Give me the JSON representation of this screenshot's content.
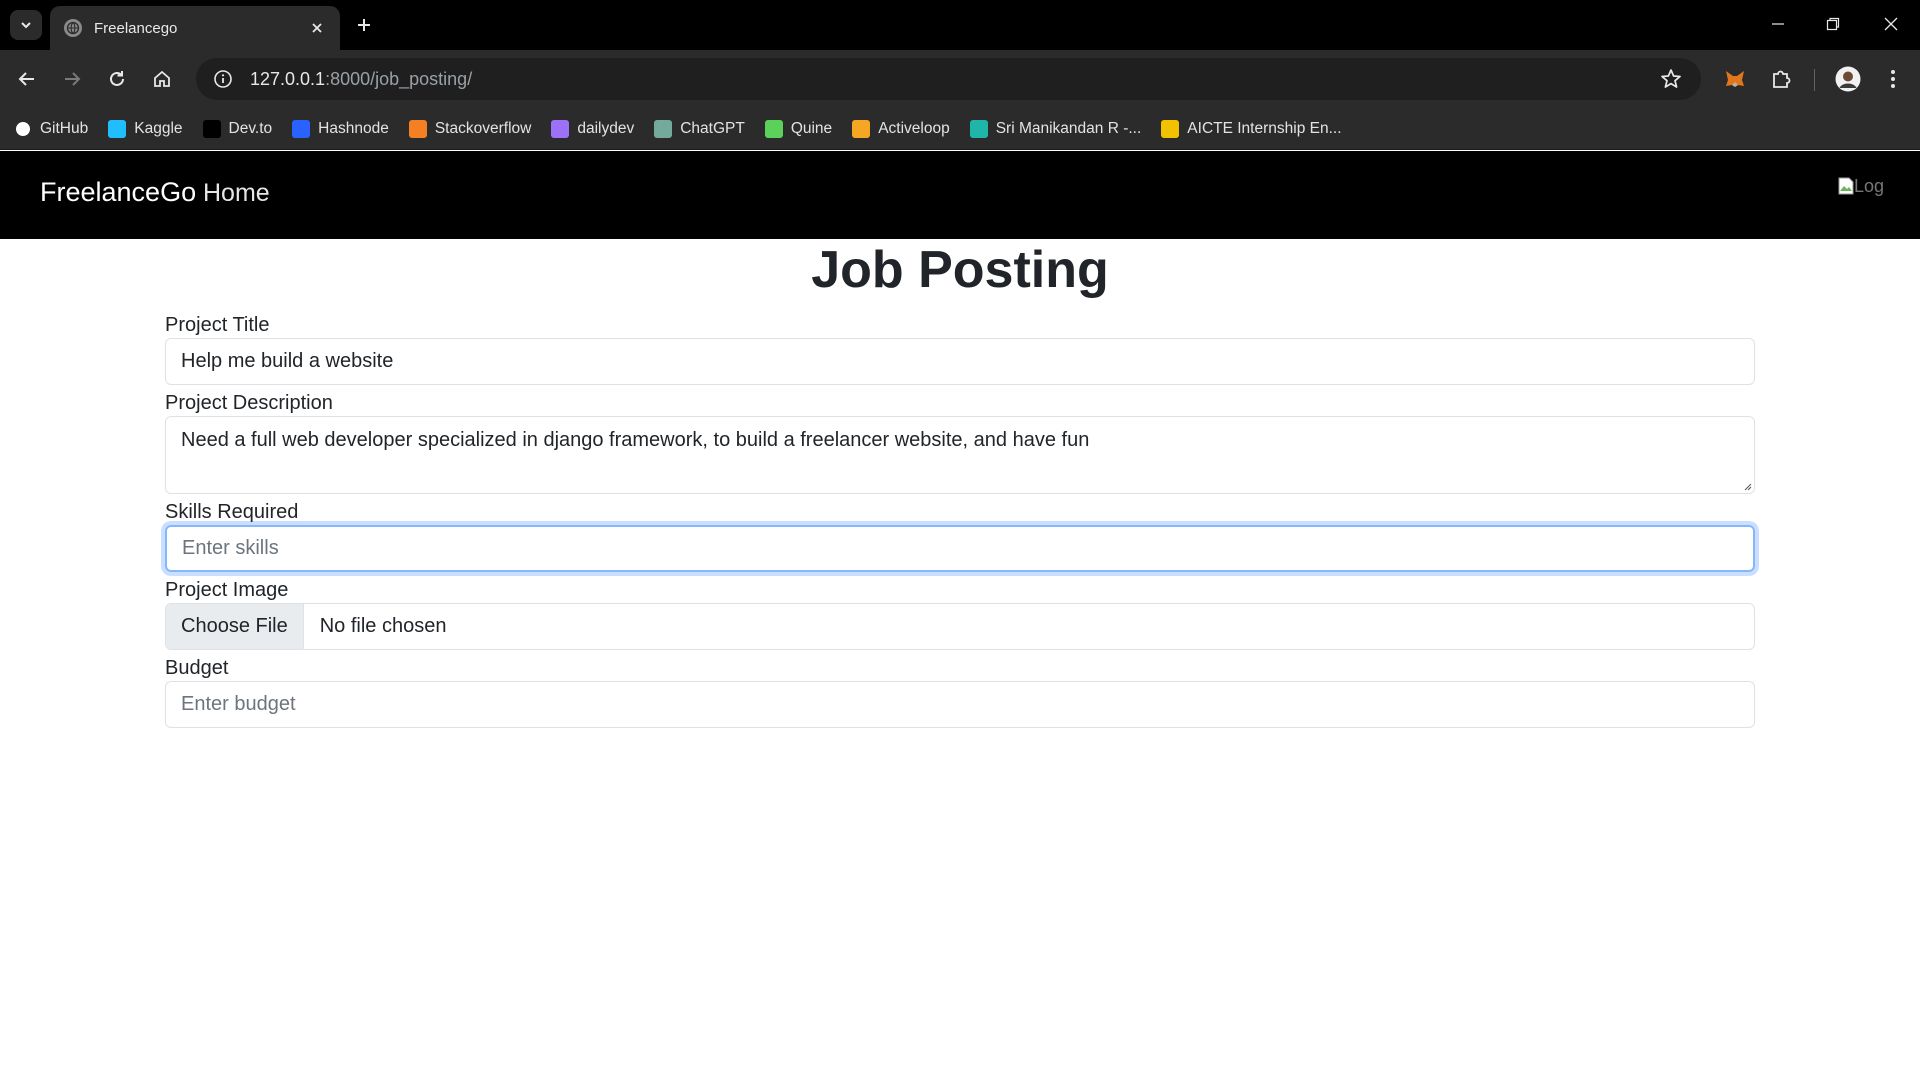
{
  "browser": {
    "tab_title": "Freelancego",
    "url_host": "127.0.0.1",
    "url_rest": ":8000/job_posting/",
    "bookmarks": [
      {
        "label": "GitHub",
        "icon": "github-icon",
        "color": "#ffffff"
      },
      {
        "label": "Kaggle",
        "icon": "kaggle-icon",
        "color": "#20beff"
      },
      {
        "label": "Dev.to",
        "icon": "devto-icon",
        "color": "#000000"
      },
      {
        "label": "Hashnode",
        "icon": "hashnode-icon",
        "color": "#2962ff"
      },
      {
        "label": "Stackoverflow",
        "icon": "stackoverflow-icon",
        "color": "#f48024"
      },
      {
        "label": "dailydev",
        "icon": "dailydev-icon",
        "color": "#9d70f8"
      },
      {
        "label": "ChatGPT",
        "icon": "chatgpt-icon",
        "color": "#74aa9c"
      },
      {
        "label": "Quine",
        "icon": "quine-icon",
        "color": "#5bd15b"
      },
      {
        "label": "Activeloop",
        "icon": "activeloop-icon",
        "color": "#f5a623"
      },
      {
        "label": "Sri Manikandan R -...",
        "icon": "codechef-icon",
        "color": "#1fb5a8"
      },
      {
        "label": "AICTE Internship En...",
        "icon": "aicte-icon",
        "color": "#f2c200"
      }
    ]
  },
  "nav": {
    "brand": "FreelanceGo",
    "home": "Home",
    "logo_alt": "Log"
  },
  "page": {
    "title": "Job Posting"
  },
  "form": {
    "project_title_label": "Project Title",
    "project_title_value": "Help me build a website",
    "description_label": "Project Description",
    "description_value": "Need a full web developer specialized in django framework, to build a freelancer website, and have fun",
    "skills_label": "Skills Required",
    "skills_placeholder": "Enter skills",
    "image_label": "Project Image",
    "file_button": "Choose File",
    "file_status": "No file chosen",
    "budget_label": "Budget",
    "budget_placeholder": "Enter budget"
  }
}
